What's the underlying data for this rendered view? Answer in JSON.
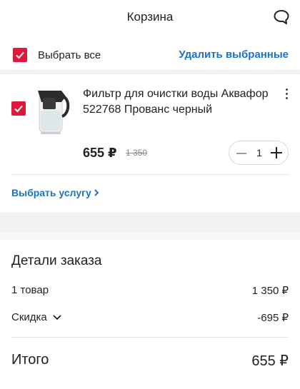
{
  "header": {
    "title": "Корзина"
  },
  "select_all": {
    "label": "Выбрать все",
    "delete_label": "Удалить выбранные"
  },
  "item": {
    "name": "Фильтр для очистки воды Аквафор 522768 Прованс черный",
    "price": "655 ₽",
    "old_price": "1 350",
    "quantity": "1"
  },
  "service": {
    "label": "Выбрать услугу"
  },
  "order": {
    "title": "Детали заказа",
    "goods_label": "1 товар",
    "goods_value": "1 350 ₽",
    "discount_label": "Скидка",
    "discount_value": "-695 ₽",
    "total_label": "Итого",
    "total_value": "655 ₽"
  },
  "colors": {
    "accent": "#e0183c",
    "link": "#1a73c8"
  }
}
